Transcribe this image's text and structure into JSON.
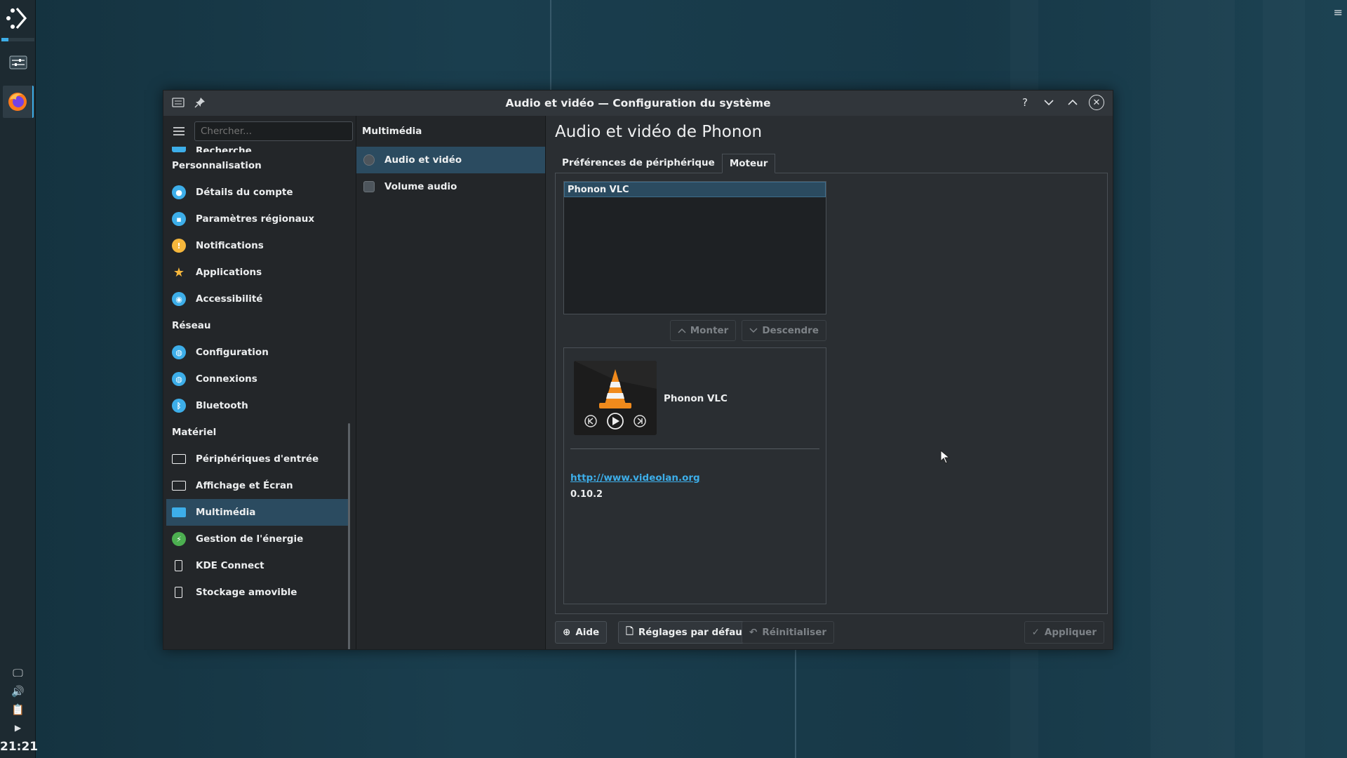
{
  "window": {
    "title": "Audio et vidéo — Configuration du système"
  },
  "taskbar": {
    "clock": "21:21"
  },
  "sidebar": {
    "search_placeholder": "Chercher...",
    "partial_top_item": "Recherche",
    "categories": [
      {
        "label": "Personnalisation",
        "items": [
          {
            "label": "Détails du compte",
            "icon": "account-icon",
            "color": "#3daee9"
          },
          {
            "label": "Paramètres régionaux",
            "icon": "region-icon",
            "color": "#3daee9"
          },
          {
            "label": "Notifications",
            "icon": "notification-icon",
            "color": "#f6b73c"
          },
          {
            "label": "Applications",
            "icon": "star-icon",
            "color": "#f6b73c"
          },
          {
            "label": "Accessibilité",
            "icon": "accessibility-icon",
            "color": "#3daee9"
          }
        ]
      },
      {
        "label": "Réseau",
        "items": [
          {
            "label": "Configuration",
            "icon": "globe-icon",
            "color": "#3daee9"
          },
          {
            "label": "Connexions",
            "icon": "globe-icon",
            "color": "#3daee9"
          },
          {
            "label": "Bluetooth",
            "icon": "bluetooth-icon",
            "color": "#3daee9"
          }
        ]
      },
      {
        "label": "Matériel",
        "items": [
          {
            "label": "Périphériques d'entrée",
            "icon": "keyboard-icon",
            "color": "#eff0f1"
          },
          {
            "label": "Affichage et Écran",
            "icon": "monitor-icon",
            "color": "#eff0f1"
          },
          {
            "label": "Multimédia",
            "icon": "multimedia-icon",
            "color": "#3daee9",
            "selected": true
          },
          {
            "label": "Gestion de l'énergie",
            "icon": "power-icon",
            "color": "#4caf50"
          },
          {
            "label": "KDE Connect",
            "icon": "phone-icon",
            "color": "#eff0f1"
          },
          {
            "label": "Stockage amovible",
            "icon": "usb-icon",
            "color": "#eff0f1"
          }
        ]
      }
    ]
  },
  "subpanel": {
    "header": "Multimédia",
    "items": [
      {
        "label": "Audio et vidéo",
        "selected": true
      },
      {
        "label": "Volume audio",
        "selected": false
      }
    ]
  },
  "main": {
    "heading": "Audio et vidéo de Phonon",
    "tabs": [
      "Préférences de périphérique",
      "Moteur"
    ],
    "active_tab": 1,
    "backend_list": [
      "Phonon VLC"
    ],
    "move_up_label": "Monter",
    "move_down_label": "Descendre",
    "backend_name": "Phonon VLC",
    "backend_url": "http://www.videolan.org",
    "backend_version": "0.10.2"
  },
  "footer": {
    "help_label": "Aide",
    "defaults_label": "Réglages par défaut",
    "reset_label": "Réinitialiser",
    "apply_label": "Appliquer"
  }
}
